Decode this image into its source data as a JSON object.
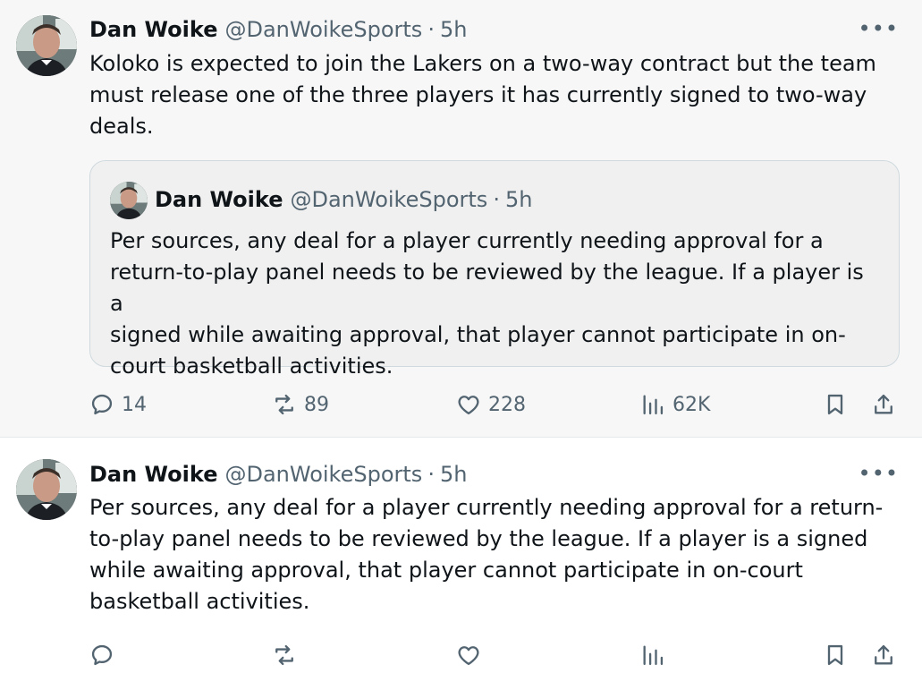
{
  "tweets": [
    {
      "author_name": "Dan Woike",
      "handle": "@DanWoikeSports",
      "separator": "·",
      "time": "5h",
      "more": "•••",
      "text": "Koloko is expected to join the Lakers on a two-way contract but the team\nmust release one of the three players it has currently signed to two-way\ndeals.",
      "quote": {
        "author_name": "Dan Woike",
        "handle": "@DanWoikeSports",
        "separator": "·",
        "time": "5h",
        "text": "Per sources, any deal for a player currently needing approval for a\nreturn-to-play panel needs to be reviewed by the league. If a player is a\nsigned while awaiting approval, that player cannot participate in on-\ncourt basketball activities."
      },
      "actions": {
        "replies": "14",
        "reposts": "89",
        "likes": "228",
        "views": "62K"
      }
    },
    {
      "author_name": "Dan Woike",
      "handle": "@DanWoikeSports",
      "separator": "·",
      "time": "5h",
      "more": "•••",
      "text": "Per sources, any deal for a player currently needing approval for a return-\nto-play panel needs to be reviewed by the league. If a player is a signed\nwhile awaiting approval, that player cannot participate in on-court\nbasketball activities."
    }
  ],
  "colors": {
    "text_primary": "#0f1419",
    "text_secondary": "#536471",
    "border": "#cfd9de"
  },
  "icons": [
    "reply-icon",
    "repost-icon",
    "like-icon",
    "views-icon",
    "bookmark-icon",
    "share-icon",
    "more-icon"
  ]
}
